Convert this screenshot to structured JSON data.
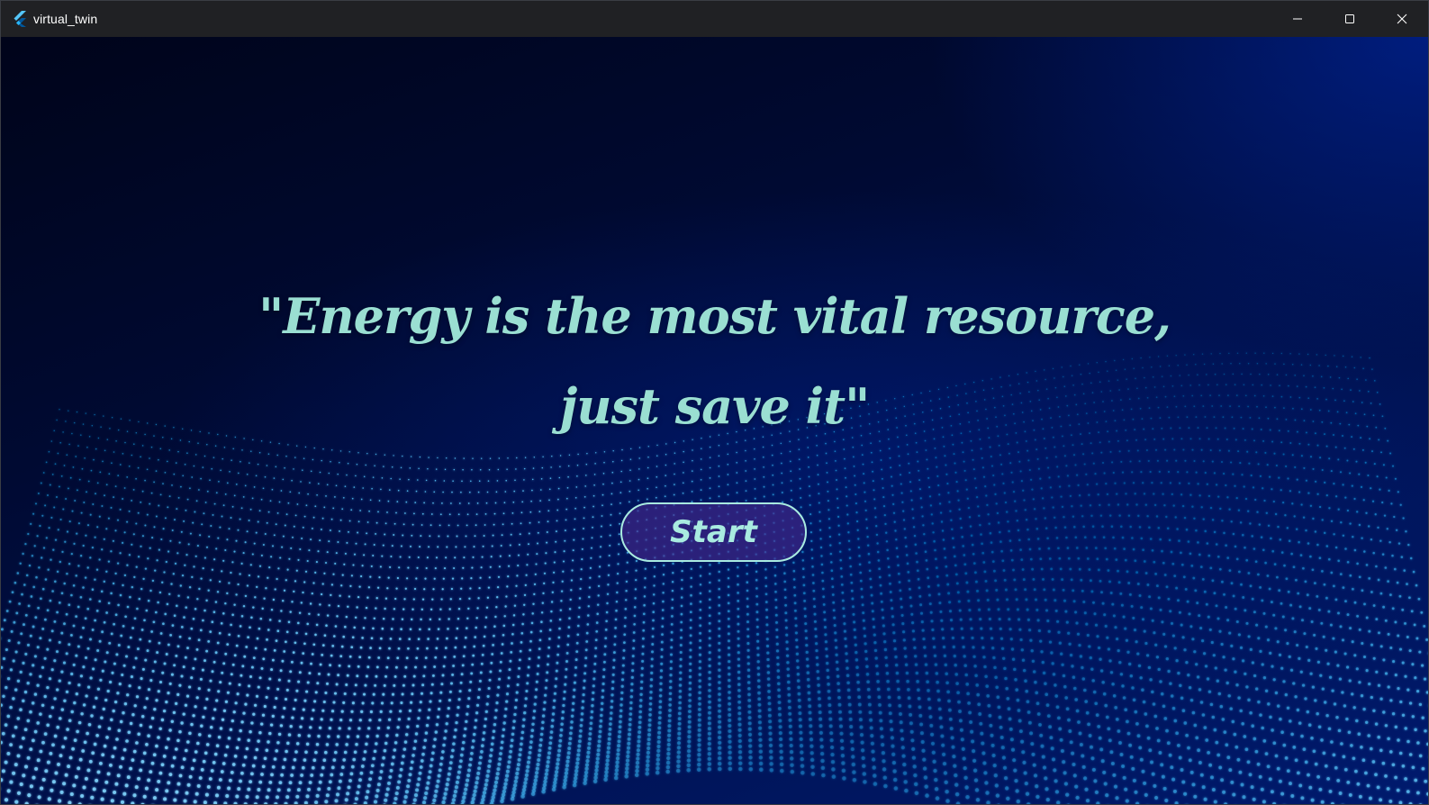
{
  "window": {
    "title": "virtual_twin",
    "icon": "flutter-logo-icon",
    "controls": [
      "minimize-icon",
      "maximize-icon",
      "close-icon"
    ]
  },
  "main": {
    "quote_line1": "\"Energy is the most vital resource,",
    "quote_line2": "just save it\"",
    "start_label": "Start"
  },
  "colors": {
    "titlebar": "#202124",
    "background_deep": "#00041a",
    "background_blue": "#001a6e",
    "quote_text": "#9adfd2",
    "button_fill": "#46288c",
    "button_border": "#a9ebe0",
    "particle_wave": "#29a8f0"
  }
}
